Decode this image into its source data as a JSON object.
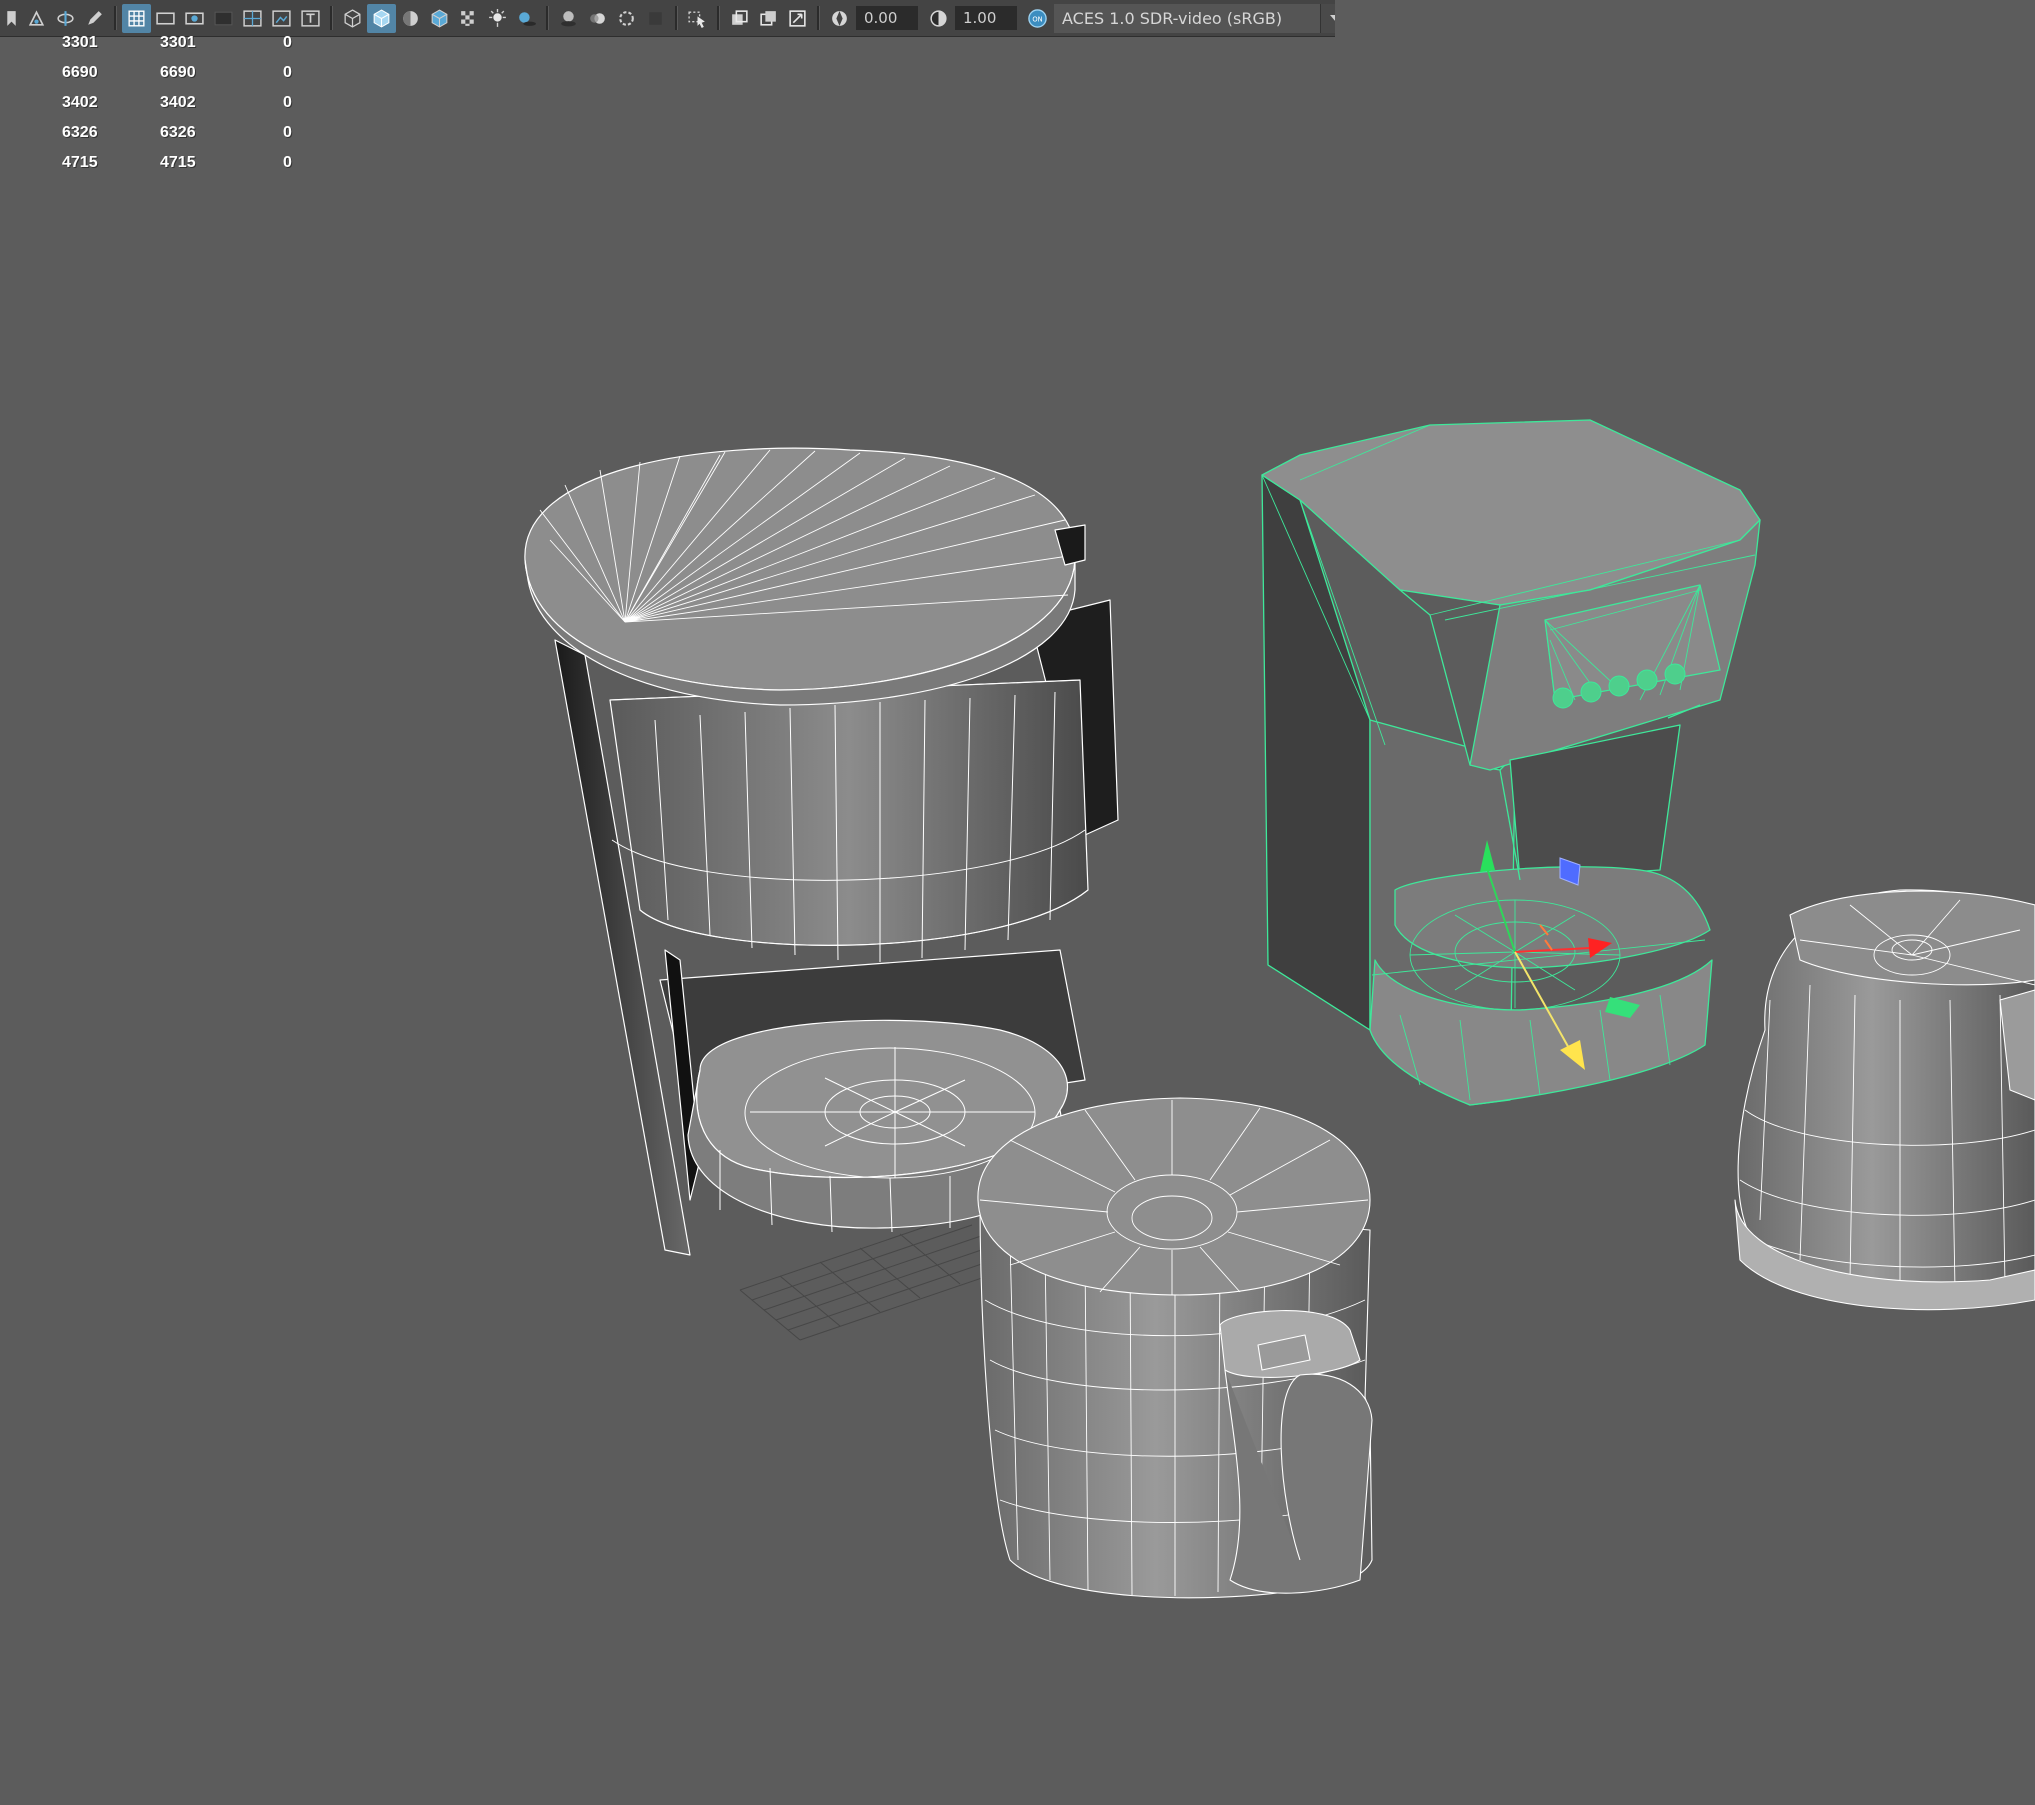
{
  "toolbar": {
    "exposure_value": "0.00",
    "gamma_value": "1.00",
    "colorspace_toggle": "ON",
    "colorspace_label": "ACES 1.0 SDR-video (sRGB)",
    "icons": [
      "bookmark-icon",
      "camera-attributes-icon",
      "camera-tumble-icon",
      "pencil-icon",
      "grid-icon",
      "film-gate-icon",
      "resolution-gate-icon",
      "gate-mask-icon",
      "field-chart-icon",
      "safe-action-icon",
      "safe-title-icon",
      "wireframe-icon",
      "smooth-shade-icon",
      "default-material-icon",
      "wireframe-on-shaded-icon",
      "xray-icon",
      "use-all-lights-icon",
      "shadows-icon",
      "screen-space-ao-icon",
      "motion-blur-icon",
      "anti-aliasing-icon",
      "depth-of-field-icon",
      "isolate-select-icon",
      "xray-joints-icon",
      "xray-active-components-icon",
      "backface-culling-icon",
      "exposure-icon",
      "gamma-icon",
      "color-management-icon",
      "chevron-down-icon"
    ],
    "active_icons": [
      "grid-icon",
      "smooth-shade-icon"
    ]
  },
  "hud": {
    "rows": [
      {
        "value": "3301",
        "selected": "3301",
        "extra": "0"
      },
      {
        "value": "6690",
        "selected": "6690",
        "extra": "0"
      },
      {
        "value": "3402",
        "selected": "3402",
        "extra": "0"
      },
      {
        "value": "6326",
        "selected": "6326",
        "extra": "0"
      },
      {
        "value": "4715",
        "selected": "4715",
        "extra": "0"
      }
    ]
  },
  "viewport": {
    "background_color": "#5c5c5c",
    "wire_color": "#ffffff",
    "selection_color": "#3ee89a",
    "objects": [
      "drip-coffee-maker",
      "coffee-carafe",
      "espresso-machine-selected",
      "second-carafe-partial"
    ]
  }
}
